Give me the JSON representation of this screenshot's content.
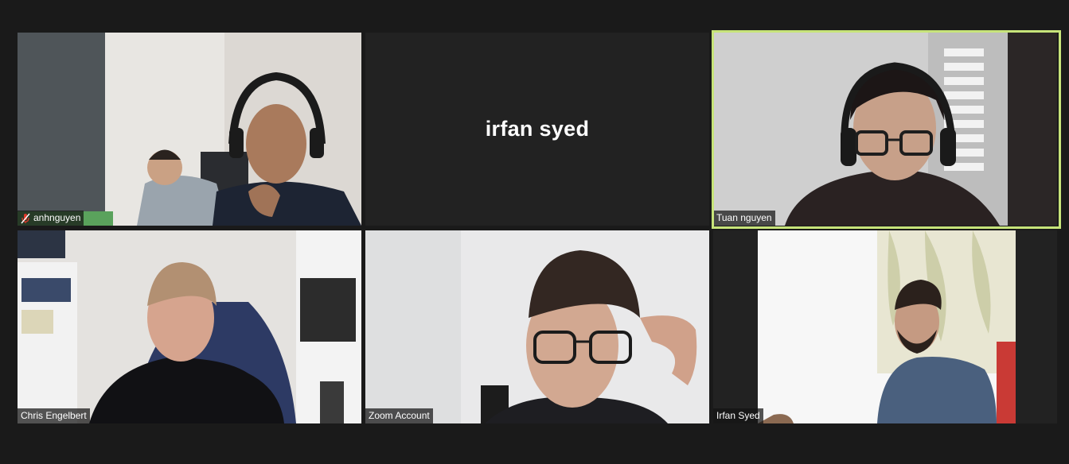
{
  "participants": [
    {
      "id": "p1",
      "name": "anhnguyen",
      "muted": true,
      "video": true
    },
    {
      "id": "p2",
      "name": "irfan syed",
      "muted": false,
      "video": false
    },
    {
      "id": "p3",
      "name": "Tuan nguyen",
      "muted": false,
      "video": true,
      "active_speaker": true
    },
    {
      "id": "p4",
      "name": "Chris Engelbert",
      "muted": false,
      "video": true
    },
    {
      "id": "p5",
      "name": "Zoom Account",
      "muted": false,
      "video": true
    },
    {
      "id": "p6",
      "name": "Irfan Syed",
      "muted": false,
      "video": true
    }
  ],
  "colors": {
    "background": "#1a1a1a",
    "tile": "#222222",
    "active_speaker_border": "#c7e47a",
    "muted_icon": "#e0392b"
  },
  "icons": {
    "muted": "mic-muted-icon"
  }
}
